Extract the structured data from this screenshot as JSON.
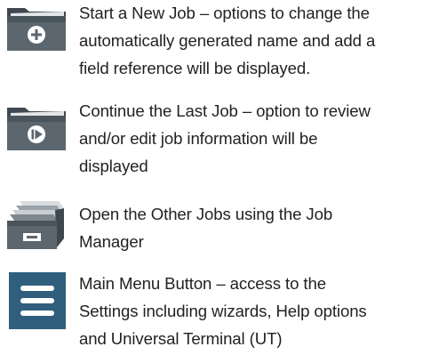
{
  "items": [
    {
      "icon": "folder-plus-icon",
      "lines": [
        "Start a New Job – options to change the",
        "automatically generated name and add a",
        "field reference will be displayed."
      ]
    },
    {
      "icon": "folder-play-icon",
      "lines": [
        "Continue the Last Job – option to review",
        "and/or edit job information will be",
        "displayed"
      ]
    },
    {
      "icon": "file-cabinet-icon",
      "lines": [
        "Open the Other Jobs using the Job",
        "Manager"
      ]
    },
    {
      "icon": "hamburger-menu-icon",
      "lines": [
        "Main Menu Button – access to the",
        "Settings including wizards, Help options",
        "and Universal Terminal (UT)"
      ]
    }
  ],
  "colors": {
    "folder_dark": "#3f4850",
    "folder_mid": "#5b666e",
    "folder_light": "#d8dcdf",
    "menu_blue": "#2f5f7c",
    "text": "#222222"
  }
}
